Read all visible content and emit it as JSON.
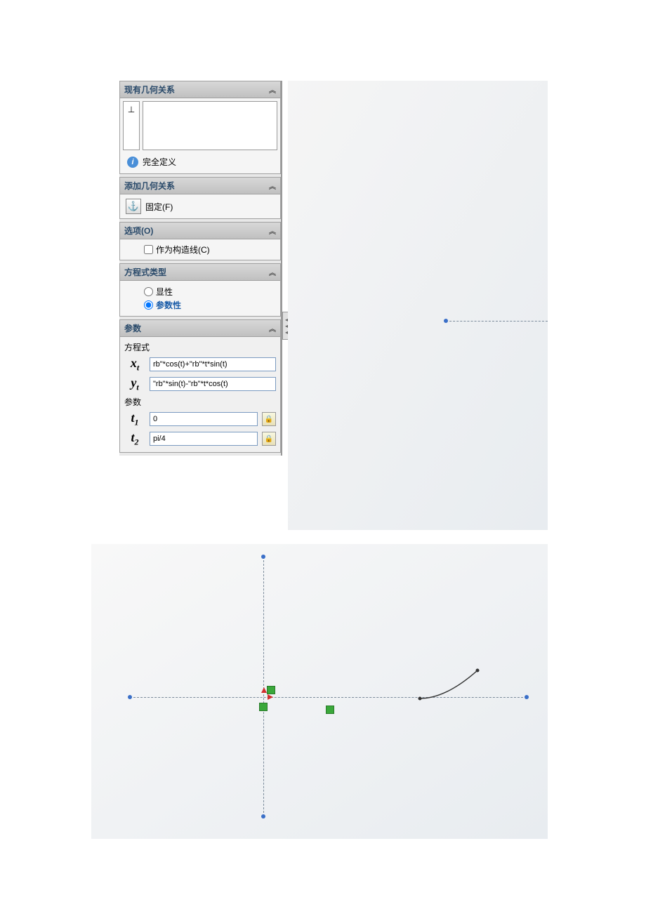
{
  "sections": {
    "existing_relations": {
      "title": "现有几何关系",
      "status": "完全定义"
    },
    "add_relations": {
      "title": "添加几何关系",
      "fix_label": "固定(F)"
    },
    "options": {
      "title": "选项(O)",
      "as_construction": "作为构造线(C)"
    },
    "equation_type": {
      "title": "方程式类型",
      "explicit": "显性",
      "parametric": "参数性"
    },
    "params": {
      "title": "参数",
      "equation_label": "方程式",
      "xt_value": "rb\"*cos(t)+\"rb\"*t*sin(t)",
      "yt_value": "\"rb\"*sin(t)-\"rb\"*t*cos(t)",
      "params_label": "参数",
      "t1_value": "0",
      "t2_value": "pi/4"
    }
  },
  "symbols": {
    "xt": "x",
    "xt_sub": "t",
    "yt": "y",
    "yt_sub": "t",
    "t1": "t",
    "t1_sub": "1",
    "t2": "t",
    "t2_sub": "2"
  }
}
